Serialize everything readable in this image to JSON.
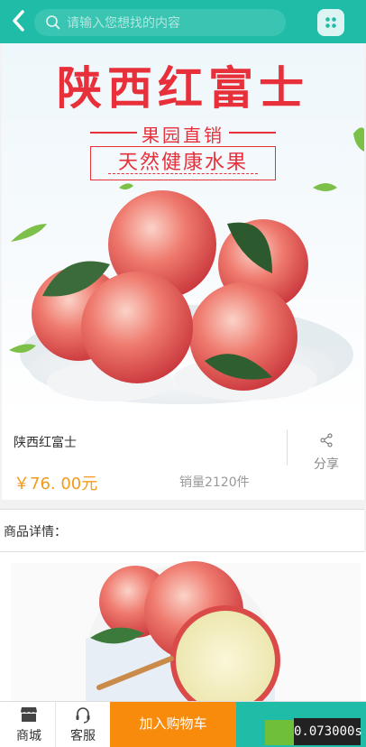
{
  "header": {
    "search_placeholder": "请输入您想找的内容",
    "icons": [
      "back-arrow-icon",
      "search-icon",
      "grid-menu-icon"
    ],
    "colors": {
      "bar": "#1fbca8"
    }
  },
  "banner": {
    "title": "陕西红富士",
    "tagline": "果园直销",
    "slogan": "天然健康水果"
  },
  "product": {
    "name": "陕西红富士",
    "price": "￥76. 00元",
    "sales": "销量2120件",
    "share_label": "分享",
    "colors": {
      "price": "#f39a1a"
    }
  },
  "details": {
    "label": "商品详情："
  },
  "bottom_bar": {
    "shop_label": "商城",
    "service_label": "客服",
    "cart_label": "加入购物车",
    "colors": {
      "cart": "#f98b0c",
      "buy": "#1fbca8"
    }
  },
  "overlay": {
    "timer_text": "0.073000s"
  }
}
